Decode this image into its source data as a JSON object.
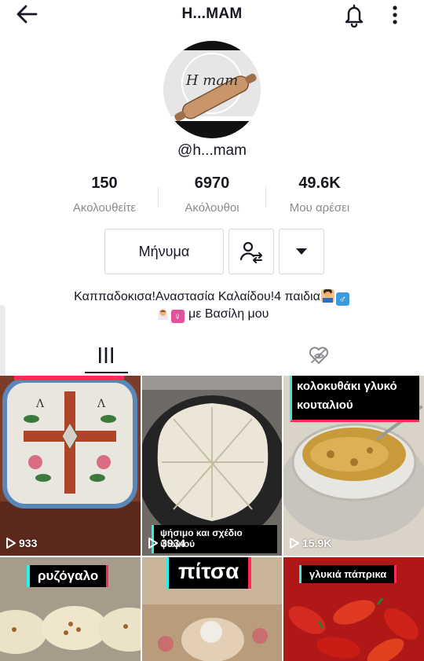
{
  "header": {
    "title": "H...MAM",
    "icons": [
      "back-arrow-icon",
      "bell-icon",
      "more-vertical-icon"
    ]
  },
  "profile": {
    "avatar_text": "H mam",
    "handle": "@h...mam"
  },
  "stats": [
    {
      "value": "150",
      "label": "Ακολουθείτε"
    },
    {
      "value": "6970",
      "label": "Ακόλουθοι"
    },
    {
      "value": "49.6K",
      "label": "Μου αρέσει"
    }
  ],
  "actions": {
    "message_label": "Μήνυμα",
    "icons": [
      "follow-swap-icon",
      "dropdown-caret-icon"
    ]
  },
  "bio": {
    "line1": "Καππαδοκισα!Αναστασία Καλαίδου!4 παιδια",
    "line2": "με Βασίλη μου",
    "emoji": [
      "man-technologist",
      "male-sign",
      "bride",
      "female-sign"
    ]
  },
  "tabs": [
    {
      "name": "videos",
      "icon": "grid-bars-icon",
      "active": true
    },
    {
      "name": "liked",
      "icon": "hidden-heart-icon",
      "active": false
    }
  ],
  "videos": [
    {
      "views": "933",
      "caption": ""
    },
    {
      "views": "3934",
      "caption": "ψήσιμο και σχέδιο ψωμιού"
    },
    {
      "views": "15.9K",
      "caption": "κολοκυθάκι γλυκό κουταλιού"
    },
    {
      "views": "",
      "caption": "ρυζόγαλο"
    },
    {
      "views": "",
      "caption": "πίτσα"
    },
    {
      "views": "",
      "caption": "γλυκιά πάπρικα"
    }
  ],
  "colors": {
    "accent_red": "#fe2c55",
    "accent_cyan": "#25f4ee",
    "text_primary": "#161823",
    "text_secondary": "#8a8b91"
  }
}
